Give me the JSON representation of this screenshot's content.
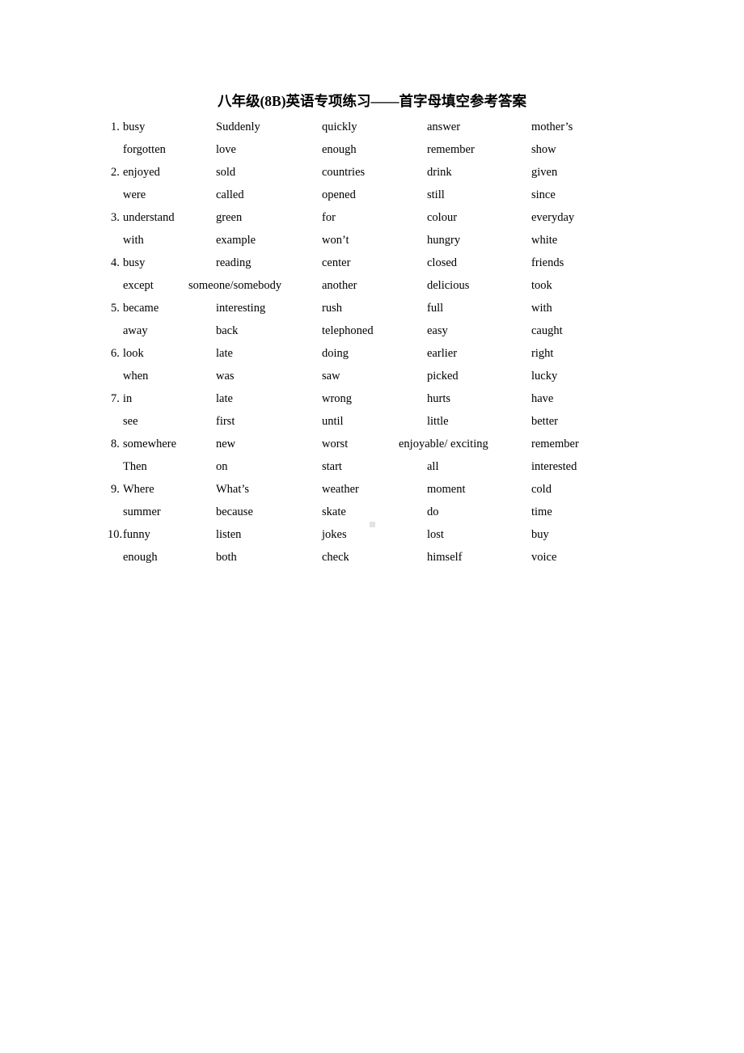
{
  "document": {
    "title": "八年级(8B)英语专项练习——首字母填空参考答案"
  },
  "answers": {
    "items": [
      {
        "number": "1.",
        "line1": [
          "busy",
          "Suddenly",
          "quickly",
          "answer",
          "mother’s"
        ],
        "line2": [
          "forgotten",
          "love",
          "enough",
          "remember",
          "show"
        ]
      },
      {
        "number": "2.",
        "line1": [
          "enjoyed",
          "sold",
          "countries",
          "drink",
          "given"
        ],
        "line2": [
          "were",
          "called",
          "opened",
          "still",
          "since"
        ]
      },
      {
        "number": "3.",
        "line1": [
          "understand",
          "green",
          "for",
          "colour",
          "everyday"
        ],
        "line2": [
          "with",
          "example",
          "won’t",
          "hungry",
          "white"
        ]
      },
      {
        "number": "4.",
        "line1": [
          "busy",
          "reading",
          "center",
          "closed",
          "friends"
        ],
        "line2": [
          "except",
          "someone/somebody",
          "another",
          "delicious",
          "took"
        ]
      },
      {
        "number": "5.",
        "line1": [
          "became",
          "interesting",
          "rush",
          "full",
          "with"
        ],
        "line2": [
          "away",
          "back",
          "telephoned",
          "easy",
          "caught"
        ]
      },
      {
        "number": "6.",
        "line1": [
          "look",
          "late",
          "doing",
          "earlier",
          "right"
        ],
        "line2": [
          "when",
          "was",
          "saw",
          "picked",
          "lucky"
        ]
      },
      {
        "number": "7.",
        "line1": [
          "in",
          "late",
          "wrong",
          "hurts",
          "have"
        ],
        "line2": [
          "see",
          "first",
          "until",
          "little",
          "better"
        ]
      },
      {
        "number": "8.",
        "line1": [
          "somewhere",
          "new",
          "worst",
          "enjoyable/ exciting",
          "remember"
        ],
        "line2": [
          "Then",
          "on",
          "start",
          "all",
          "interested"
        ]
      },
      {
        "number": "9.",
        "line1": [
          "Where",
          "What’s",
          "weather",
          "moment",
          "cold"
        ],
        "line2": [
          "summer",
          "because",
          "skate",
          "do",
          "time"
        ]
      },
      {
        "number": "10.",
        "line1": [
          "funny",
          "listen",
          "jokes",
          "lost",
          "buy"
        ],
        "line2": [
          "enough",
          "both",
          "check",
          "himself",
          "voice"
        ]
      }
    ]
  },
  "colors": {
    "page_background": "#ffffff",
    "text": "#000000",
    "artifact": "#e3e3e3"
  }
}
